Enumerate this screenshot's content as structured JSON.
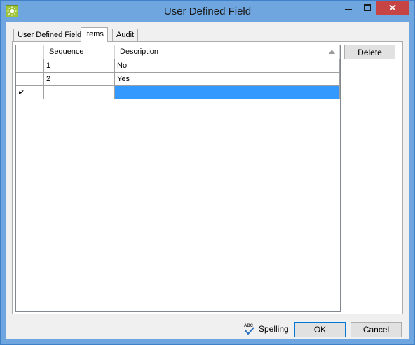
{
  "window": {
    "title": "User Defined Field",
    "icon": "app-sun-icon"
  },
  "tabs": [
    {
      "label": "User Defined Field"
    },
    {
      "label": "Items"
    },
    {
      "label": "Audit"
    }
  ],
  "grid": {
    "columns": [
      "Sequence",
      "Description"
    ],
    "rows": [
      {
        "sequence": "1",
        "description": "No"
      },
      {
        "sequence": "2",
        "description": "Yes"
      }
    ],
    "new_row_marker": "▸*"
  },
  "buttons": {
    "delete": "Delete",
    "spelling": "Spelling",
    "ok": "OK",
    "cancel": "Cancel"
  },
  "colors": {
    "selection": "#3399ff",
    "close_button": "#c74444",
    "title_bar": "#6fa6df"
  }
}
